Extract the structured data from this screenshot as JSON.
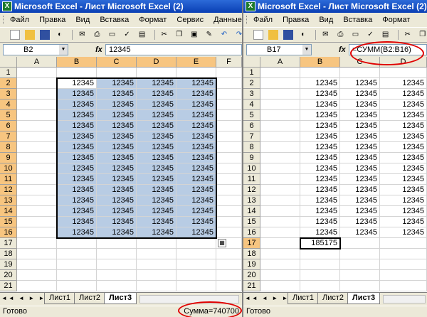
{
  "left": {
    "title": "Microsoft Excel - Лист Microsoft Excel (2)",
    "menu": [
      "Файл",
      "Правка",
      "Вид",
      "Вставка",
      "Формат",
      "Сервис",
      "Данные"
    ],
    "namebox": "B2",
    "formula": "12345",
    "columns": [
      "A",
      "B",
      "C",
      "D",
      "E",
      "F"
    ],
    "rows": [
      "1",
      "2",
      "3",
      "4",
      "5",
      "6",
      "7",
      "8",
      "9",
      "10",
      "11",
      "12",
      "13",
      "14",
      "15",
      "16",
      "17",
      "18",
      "19",
      "20",
      "21"
    ],
    "cell_value": "12345",
    "tabs": [
      "Лист1",
      "Лист2",
      "Лист3"
    ],
    "status_left": "Готово",
    "status_sum": "Сумма=740700"
  },
  "right": {
    "title": "Microsoft Excel - Лист Microsoft Excel (2)",
    "menu": [
      "Файл",
      "Правка",
      "Вид",
      "Вставка",
      "Формат"
    ],
    "namebox": "B17",
    "formula": "=СУММ(B2:B16)",
    "columns": [
      "A",
      "B",
      "C",
      "D"
    ],
    "rows": [
      "1",
      "2",
      "3",
      "4",
      "5",
      "6",
      "7",
      "8",
      "9",
      "10",
      "11",
      "12",
      "13",
      "14",
      "15",
      "16",
      "17",
      "18",
      "19",
      "20",
      "21"
    ],
    "cell_value": "12345",
    "sum_value": "185175",
    "tabs": [
      "Лист1",
      "Лист2",
      "Лист3"
    ],
    "status_left": "Готово"
  },
  "icons": [
    "grip-icon",
    "new-icon",
    "open-icon",
    "save-icon",
    "permission-icon",
    "mail-icon",
    "print-icon",
    "preview-icon",
    "spell-icon",
    "research-icon",
    "cut-icon",
    "copy-icon",
    "paste-icon",
    "format-painter-icon",
    "undo-icon",
    "redo-icon",
    "hyperlink-icon"
  ],
  "colors": {
    "title_bar": "#0a3fb4",
    "selection": "#b8cce4",
    "header_sel": "#f7c580",
    "highlight_circle": "#e00000"
  }
}
